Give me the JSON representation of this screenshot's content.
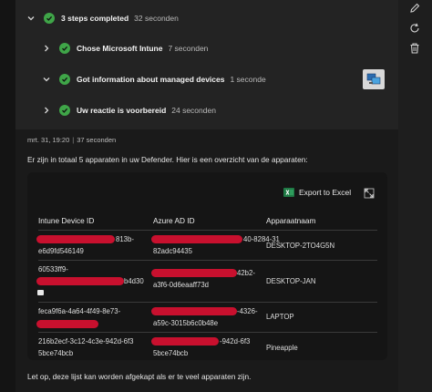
{
  "steps": [
    {
      "title": "3 steps completed",
      "duration": "32 seconden",
      "expanded": true
    },
    {
      "title": "Chose Microsoft Intune",
      "duration": "7 seconden",
      "expanded": false
    },
    {
      "title": "Got information about managed devices",
      "duration": "1 seconde",
      "expanded": true
    },
    {
      "title": "Uw reactie is voorbereid",
      "duration": "24 seconden",
      "expanded": false
    }
  ],
  "rail_icons": [
    "edit-icon",
    "refresh-icon",
    "delete-icon"
  ],
  "message": {
    "date": "mrt. 31, 19:20",
    "separator": "|",
    "duration": "37 seconden",
    "intro": "Er zijn in totaal 5 apparaten in uw Defender. Hier is een overzicht van de apparaten:",
    "footer": "Let op, deze lijst kan worden afgekapt als er te veel apparaten zijn."
  },
  "table": {
    "export_label": "Export to Excel",
    "headers": [
      "Intune Device ID",
      "Azure AD ID",
      "Apparaatnaam"
    ],
    "rows": [
      {
        "intune_lines": [
          "813b-",
          "e6d9fd546149"
        ],
        "azure_lines": [
          "40-8284-31",
          "82adc94435"
        ],
        "name": "DESKTOP-2TO4G5N"
      },
      {
        "intune_lines": [
          "60533ff9-",
          "b4d30"
        ],
        "azure_lines": [
          "42b2-",
          "a3f6-0d6eaaff73d"
        ],
        "name": "DESKTOP-JAN"
      },
      {
        "intune_lines": [
          "feca9f6a-4a64-4f49-8e73-",
          ""
        ],
        "azure_lines": [
          "-4326-",
          "a59c-3015b6c0b48e"
        ],
        "name": "LAPTOP"
      },
      {
        "intune_lines": [
          "216b2ecf-3c12-4c3e-942d-6f3",
          "5bce74bcb"
        ],
        "azure_lines": [
          "-942d-6f3",
          "5bce74bcb"
        ],
        "name": "Pineapple"
      }
    ]
  },
  "colors": {
    "check": "#3fa548",
    "redaction": "#c8102e",
    "excel": "#1f7a45"
  }
}
